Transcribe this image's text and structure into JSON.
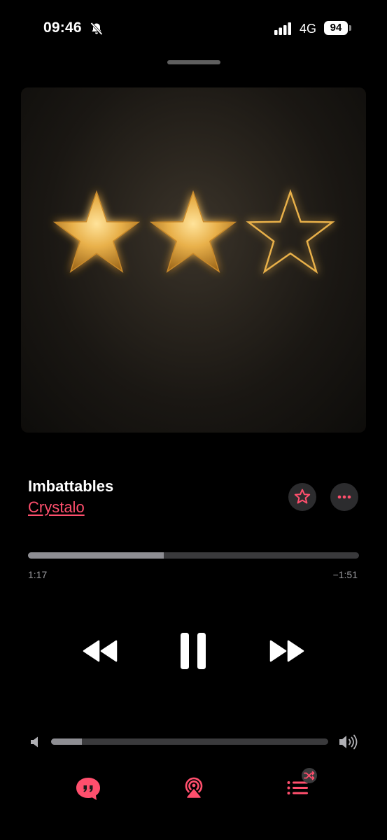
{
  "status_bar": {
    "time": "09:46",
    "network": "4G",
    "battery": "94"
  },
  "artwork": {
    "rating": 2,
    "rating_max": 3,
    "star_color": "#e8b04a"
  },
  "track": {
    "title": "Imbattables",
    "artist": "Crystalo"
  },
  "playback": {
    "elapsed": "1:17",
    "remaining": "−1:51",
    "progress_fraction": 0.41,
    "state": "playing"
  },
  "volume": {
    "level_fraction": 0.11
  },
  "colors": {
    "accent": "#ff4f6d",
    "background": "#000000",
    "track": "#3a3a3c",
    "fill": "#8e8e93"
  },
  "icons": {
    "mute": "bell-slash-icon",
    "favorite": "star-outline-icon",
    "more": "ellipsis-icon",
    "rewind": "backward-icon",
    "pause": "pause-icon",
    "forward": "forward-icon",
    "lyrics": "quote-bubble-icon",
    "airplay": "airplay-audio-icon",
    "queue": "list-shuffle-icon"
  }
}
